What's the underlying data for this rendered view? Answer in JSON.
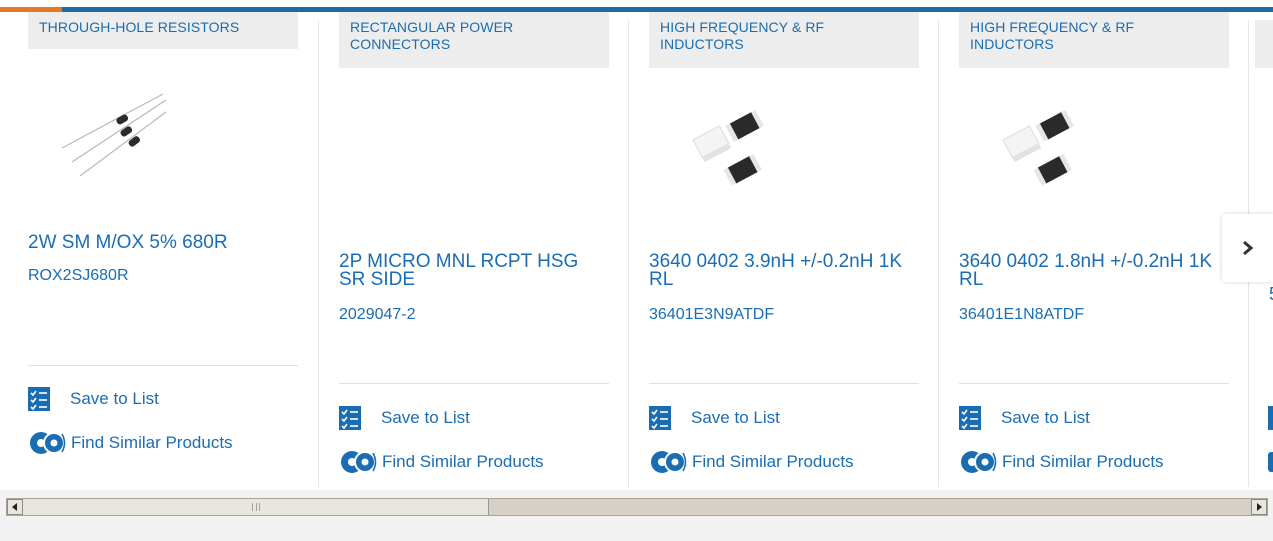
{
  "colors": {
    "accent_blue": "#1f6aa3",
    "accent_orange": "#e87722",
    "link": "#1a6db3"
  },
  "actions": {
    "save_label": "Save to List",
    "similar_label": "Find Similar Products"
  },
  "carousel": {
    "next_icon": "chevron-right-icon",
    "cards": [
      {
        "category": "THROUGH-HOLE RESISTORS",
        "title": "2W SM M/OX 5% 680R",
        "part": "ROX2SJ680R",
        "image": "resistor-image"
      },
      {
        "category": "RECTANGULAR POWER CONNECTORS",
        "title": "2P MICRO MNL RCPT HSG SR SIDE",
        "part": "2029047-2",
        "image": ""
      },
      {
        "category": "HIGH FREQUENCY & RF INDUCTORS",
        "title": "3640 0402 3.9nH +/-0.2nH 1K RL",
        "part": "36401E3N9ATDF",
        "image": "inductor-chip-image"
      },
      {
        "category": "HIGH FREQUENCY & RF INDUCTORS",
        "title": "3640 0402 1.8nH +/-0.2nH 1K RL",
        "part": "36401E1N8ATDF",
        "image": "inductor-chip-image"
      }
    ]
  },
  "peek": {
    "text": "5"
  }
}
